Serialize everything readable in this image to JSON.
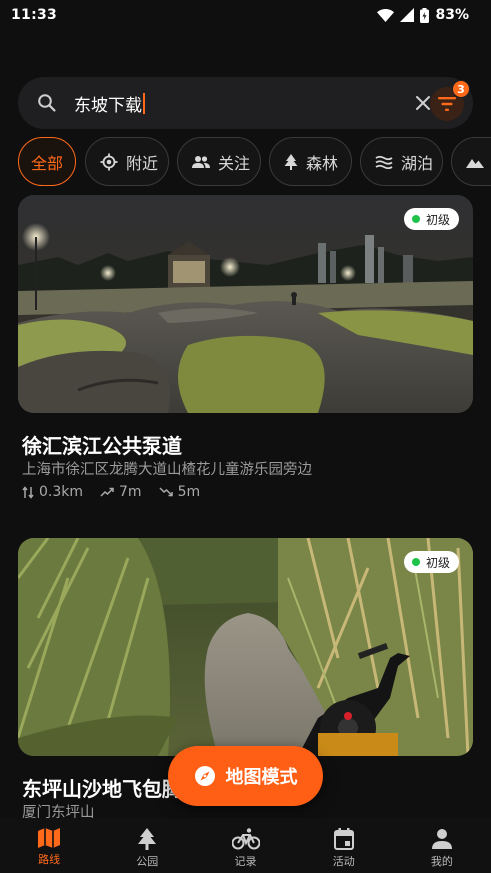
{
  "status_bar": {
    "time": "11:33",
    "battery": "83%"
  },
  "search": {
    "query": "东坡下载",
    "filter_count": "3"
  },
  "chips": [
    {
      "label": "全部",
      "icon": "none"
    },
    {
      "label": "附近",
      "icon": "location-target-icon"
    },
    {
      "label": "关注",
      "icon": "people-icon"
    },
    {
      "label": "森林",
      "icon": "tree-icon"
    },
    {
      "label": "湖泊",
      "icon": "waves-icon"
    },
    {
      "label": "",
      "icon": "mountain-icon"
    }
  ],
  "cards": [
    {
      "level": "初级",
      "title": "徐汇滨江公共泵道",
      "address": "上海市徐汇区龙腾大道山楂花儿童游乐园旁边",
      "distance": "0.3km",
      "ascent": "7m",
      "descent": "5m"
    },
    {
      "level": "初级",
      "title": "东坪山沙地飞包腾",
      "address": "厦门东坪山"
    }
  ],
  "map_button": {
    "label": "地图模式"
  },
  "bottom_nav": [
    {
      "label": "路线",
      "icon": "map-icon",
      "active": true
    },
    {
      "label": "公园",
      "icon": "tree-icon",
      "active": false
    },
    {
      "label": "记录",
      "icon": "bicycle-icon",
      "active": false
    },
    {
      "label": "活动",
      "icon": "calendar-icon",
      "active": false
    },
    {
      "label": "我的",
      "icon": "person-icon",
      "active": false
    }
  ],
  "colors": {
    "accent": "#ff6a1a",
    "background": "#0f0f10",
    "level_green": "#1ec44a"
  }
}
